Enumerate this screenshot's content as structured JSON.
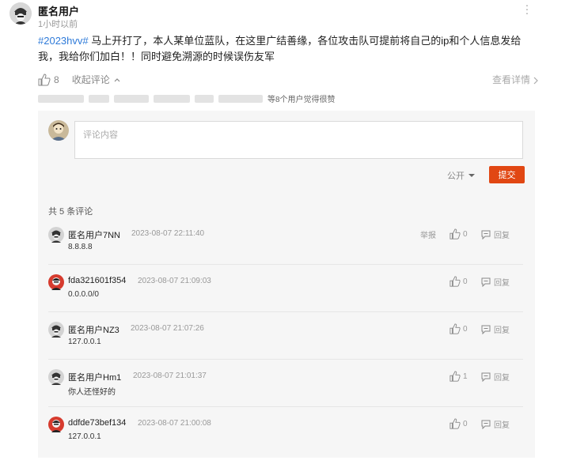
{
  "post": {
    "author": "匿名用户",
    "time": "1小时以前",
    "hashtag": "#2023hvv#",
    "text": " 马上开打了，本人某单位蓝队，在这里广结善缘，各位攻击队可提前将自己的ip和个人信息发给我，我给你们加白！！同时避免溯源的时候误伤友军",
    "like_count": "8",
    "collapse_label": "收起评论",
    "view_details": "查看详情",
    "likers_text": "等8个用户觉得很赞"
  },
  "comment_form": {
    "placeholder": "评论内容",
    "visibility": "公开",
    "submit": "提交"
  },
  "comments_header": "共 5 条评论",
  "comments": [
    {
      "author": "匿名用户7NN",
      "time": "2023-08-07 22:11:40",
      "content": "8.8.8.8",
      "likes": "0",
      "report": "举报",
      "reply": "回复",
      "avatar": "anon"
    },
    {
      "author": "fda321601f354",
      "time": "2023-08-07 21:09:03",
      "content": "0.0.0.0/0",
      "likes": "0",
      "reply": "回复",
      "avatar": "red"
    },
    {
      "author": "匿名用户NZ3",
      "time": "2023-08-07 21:07:26",
      "content": "127.0.0.1",
      "likes": "0",
      "reply": "回复",
      "avatar": "anon"
    },
    {
      "author": "匿名用户Hm1",
      "time": "2023-08-07 21:01:37",
      "content": "你人还怪好的",
      "likes": "1",
      "reply": "回复",
      "avatar": "anon"
    },
    {
      "author": "ddfde73bef134",
      "time": "2023-08-07 21:00:08",
      "content": "127.0.0.1",
      "likes": "0",
      "reply": "回复",
      "avatar": "red"
    }
  ],
  "colors": {
    "accent": "#e14713",
    "link": "#2f7bd9"
  }
}
